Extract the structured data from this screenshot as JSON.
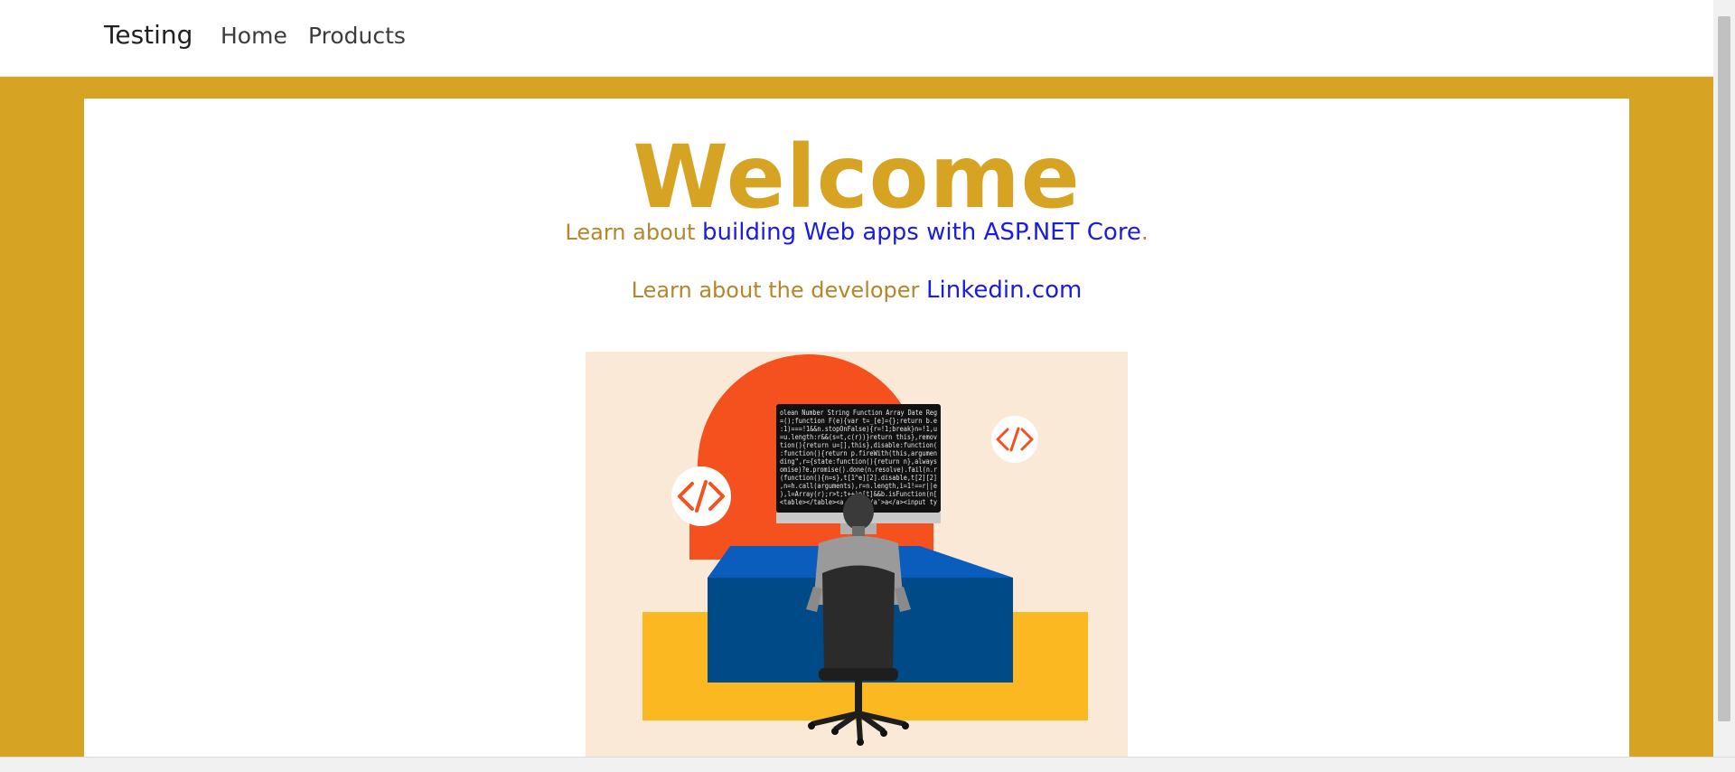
{
  "navbar": {
    "brand": "Testing",
    "links": [
      "Home",
      "Products"
    ]
  },
  "main": {
    "title": "Welcome",
    "line1_prefix": "Learn about ",
    "line1_link": "building Web apps with ASP.NET Core",
    "line1_suffix": ".",
    "line2_prefix": "Learn about the developer ",
    "line2_link": "Linkedin.com"
  },
  "code_lines": [
    "olean Number String Function Array Date Reg",
    "=();function F(e){var t=_[e]={};return b.e",
    ":1)===!1&&n.stopOnFalse){r=!1;break}n=!1,u",
    "=u.length:r&&(s=t,c(r))}return this},remov",
    "tion(){return u=[],this},disable:function(",
    ":function(){return p.fireWith(this,argumen",
    "ding\",r={state:function(){return n},always",
    "omise)?e.promise().done(n.resolve).fail(n.r",
    "(function(){n=s},t[1^e][2].disable,t[2][2]",
    ",n=h.call(arguments),r=n.length,i=1!==r||e",
    "),l=Array(r);r>t;t++)n[t]&&b.isFunction(n[",
    "<table></table><a href='/a'>a</a><input ty"
  ],
  "colors": {
    "gold": "#d6a322",
    "link": "#1b1be6",
    "text_muted": "#b5862a",
    "orange": "#f4511e",
    "navy": "#004b87",
    "blue": "#0a5dbd",
    "yellow": "#fcb821",
    "peach": "#fbe9d7"
  }
}
